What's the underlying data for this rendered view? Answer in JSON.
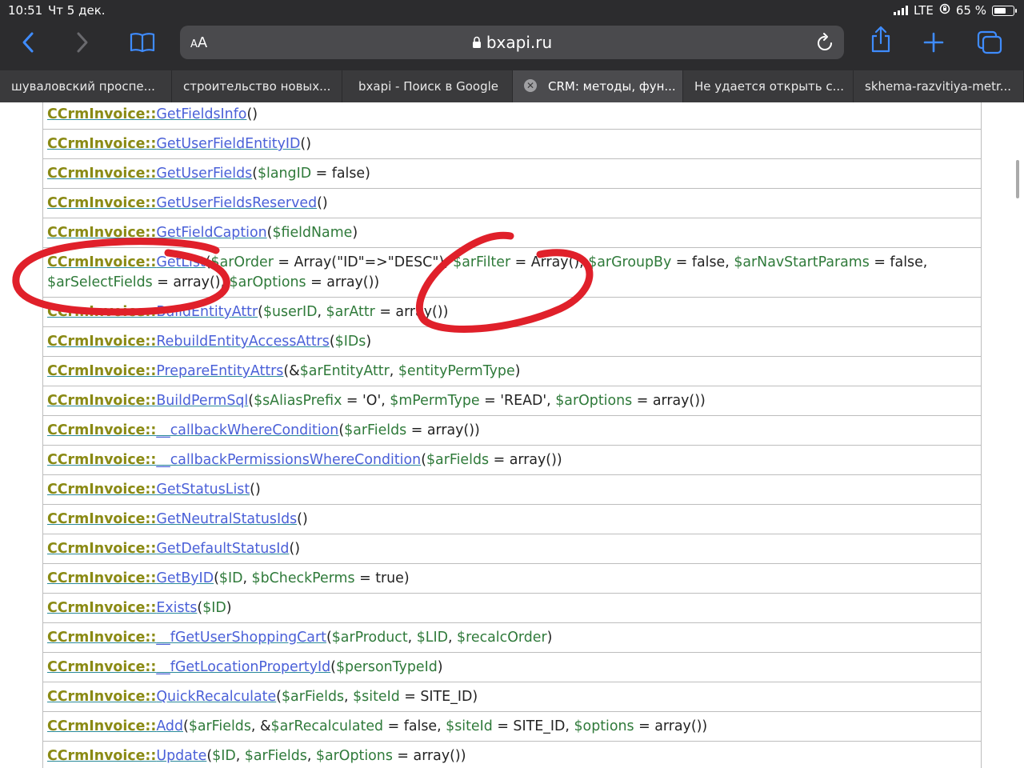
{
  "status": {
    "time": "10:51",
    "date": "Чт 5 дек.",
    "network": "LTE",
    "battery": "65 %",
    "battery_level": 0.65
  },
  "address": {
    "text_size": "AA",
    "host": "bxapi.ru"
  },
  "tabs": [
    {
      "title": "шуваловский проспе..."
    },
    {
      "title": "строительство новых..."
    },
    {
      "title": "bxapi - Поиск в Google"
    },
    {
      "title": "CRM: методы, фун..."
    },
    {
      "title": "Не удается открыть с..."
    },
    {
      "title": "skhema-razvitiya-metr..."
    }
  ],
  "methods": {
    "class_prefix": "CCrmInvoice::",
    "rows": [
      {
        "name": "GetFieldsInfo",
        "args": [
          {
            "t": "()",
            "v": false
          }
        ]
      },
      {
        "name": "GetUserFieldEntityID",
        "args": [
          {
            "t": "()",
            "v": false
          }
        ]
      },
      {
        "name": "GetUserFields",
        "args": [
          {
            "t": "(",
            "v": false
          },
          {
            "t": "$langID",
            "v": true
          },
          {
            "t": " = false)",
            "v": false
          }
        ]
      },
      {
        "name": "GetUserFieldsReserved",
        "args": [
          {
            "t": "()",
            "v": false
          }
        ]
      },
      {
        "name": "GetFieldCaption",
        "args": [
          {
            "t": "(",
            "v": false
          },
          {
            "t": "$fieldName",
            "v": true
          },
          {
            "t": ")",
            "v": false
          }
        ]
      },
      {
        "name": "GetList",
        "args": [
          {
            "t": "(",
            "v": false
          },
          {
            "t": "$arOrder",
            "v": true
          },
          {
            "t": " = Array(\"ID\"=>\"DESC\"), ",
            "v": false
          },
          {
            "t": "$arFilter",
            "v": true
          },
          {
            "t": " = Array(), ",
            "v": false
          },
          {
            "t": "$arGroupBy",
            "v": true
          },
          {
            "t": " = false, ",
            "v": false
          },
          {
            "t": "$arNavStartParams",
            "v": true
          },
          {
            "t": " = false, ",
            "v": false
          },
          {
            "t": "$arSelectFields",
            "v": true
          },
          {
            "t": " = array(), ",
            "v": false
          },
          {
            "t": "$arOptions",
            "v": true
          },
          {
            "t": " = array())",
            "v": false
          }
        ]
      },
      {
        "name": "BuildEntityAttr",
        "args": [
          {
            "t": "(",
            "v": false
          },
          {
            "t": "$userID",
            "v": true
          },
          {
            "t": ", ",
            "v": false
          },
          {
            "t": "$arAttr",
            "v": true
          },
          {
            "t": " = array())",
            "v": false
          }
        ]
      },
      {
        "name": "RebuildEntityAccessAttrs",
        "args": [
          {
            "t": "(",
            "v": false
          },
          {
            "t": "$IDs",
            "v": true
          },
          {
            "t": ")",
            "v": false
          }
        ]
      },
      {
        "name": "PrepareEntityAttrs",
        "args": [
          {
            "t": "(&",
            "v": false
          },
          {
            "t": "$arEntityAttr",
            "v": true
          },
          {
            "t": ", ",
            "v": false
          },
          {
            "t": "$entityPermType",
            "v": true
          },
          {
            "t": ")",
            "v": false
          }
        ]
      },
      {
        "name": "BuildPermSql",
        "args": [
          {
            "t": "(",
            "v": false
          },
          {
            "t": "$sAliasPrefix",
            "v": true
          },
          {
            "t": " = 'O', ",
            "v": false
          },
          {
            "t": "$mPermType",
            "v": true
          },
          {
            "t": " = 'READ', ",
            "v": false
          },
          {
            "t": "$arOptions",
            "v": true
          },
          {
            "t": " = array())",
            "v": false
          }
        ]
      },
      {
        "name": "__callbackWhereCondition",
        "args": [
          {
            "t": "(",
            "v": false
          },
          {
            "t": "$arFields",
            "v": true
          },
          {
            "t": " = array())",
            "v": false
          }
        ]
      },
      {
        "name": "__callbackPermissionsWhereCondition",
        "args": [
          {
            "t": "(",
            "v": false
          },
          {
            "t": "$arFields",
            "v": true
          },
          {
            "t": " = array())",
            "v": false
          }
        ]
      },
      {
        "name": "GetStatusList",
        "args": [
          {
            "t": "()",
            "v": false
          }
        ]
      },
      {
        "name": "GetNeutralStatusIds",
        "args": [
          {
            "t": "()",
            "v": false
          }
        ]
      },
      {
        "name": "GetDefaultStatusId",
        "args": [
          {
            "t": "()",
            "v": false
          }
        ]
      },
      {
        "name": "GetByID",
        "args": [
          {
            "t": "(",
            "v": false
          },
          {
            "t": "$ID",
            "v": true
          },
          {
            "t": ", ",
            "v": false
          },
          {
            "t": "$bCheckPerms",
            "v": true
          },
          {
            "t": " = true)",
            "v": false
          }
        ]
      },
      {
        "name": "Exists",
        "args": [
          {
            "t": "(",
            "v": false
          },
          {
            "t": "$ID",
            "v": true
          },
          {
            "t": ")",
            "v": false
          }
        ]
      },
      {
        "name": "__fGetUserShoppingCart",
        "args": [
          {
            "t": "(",
            "v": false
          },
          {
            "t": "$arProduct",
            "v": true
          },
          {
            "t": ", ",
            "v": false
          },
          {
            "t": "$LID",
            "v": true
          },
          {
            "t": ", ",
            "v": false
          },
          {
            "t": "$recalcOrder",
            "v": true
          },
          {
            "t": ")",
            "v": false
          }
        ]
      },
      {
        "name": "__fGetLocationPropertyId",
        "args": [
          {
            "t": "(",
            "v": false
          },
          {
            "t": "$personTypeId",
            "v": true
          },
          {
            "t": ")",
            "v": false
          }
        ]
      },
      {
        "name": "QuickRecalculate",
        "args": [
          {
            "t": "(",
            "v": false
          },
          {
            "t": "$arFields",
            "v": true
          },
          {
            "t": ", ",
            "v": false
          },
          {
            "t": "$siteId",
            "v": true
          },
          {
            "t": " = SITE_ID)",
            "v": false
          }
        ]
      },
      {
        "name": "Add",
        "args": [
          {
            "t": "(",
            "v": false
          },
          {
            "t": "$arFields",
            "v": true
          },
          {
            "t": ", &",
            "v": false
          },
          {
            "t": "$arRecalculated",
            "v": true
          },
          {
            "t": " = false, ",
            "v": false
          },
          {
            "t": "$siteId",
            "v": true
          },
          {
            "t": " = SITE_ID, ",
            "v": false
          },
          {
            "t": "$options",
            "v": true
          },
          {
            "t": " = array())",
            "v": false
          }
        ]
      },
      {
        "name": "Update",
        "args": [
          {
            "t": "(",
            "v": false
          },
          {
            "t": "$ID",
            "v": true
          },
          {
            "t": ", ",
            "v": false
          },
          {
            "t": "$arFields",
            "v": true
          },
          {
            "t": ", ",
            "v": false
          },
          {
            "t": "$arOptions",
            "v": true
          },
          {
            "t": " = array())",
            "v": false
          }
        ]
      },
      {
        "name": "",
        "args": []
      }
    ]
  },
  "colors": {
    "class_name": "#8a8a14",
    "method_link": "#4a60d8",
    "variable": "#2f7a3a",
    "annotation": "#e0202a"
  }
}
